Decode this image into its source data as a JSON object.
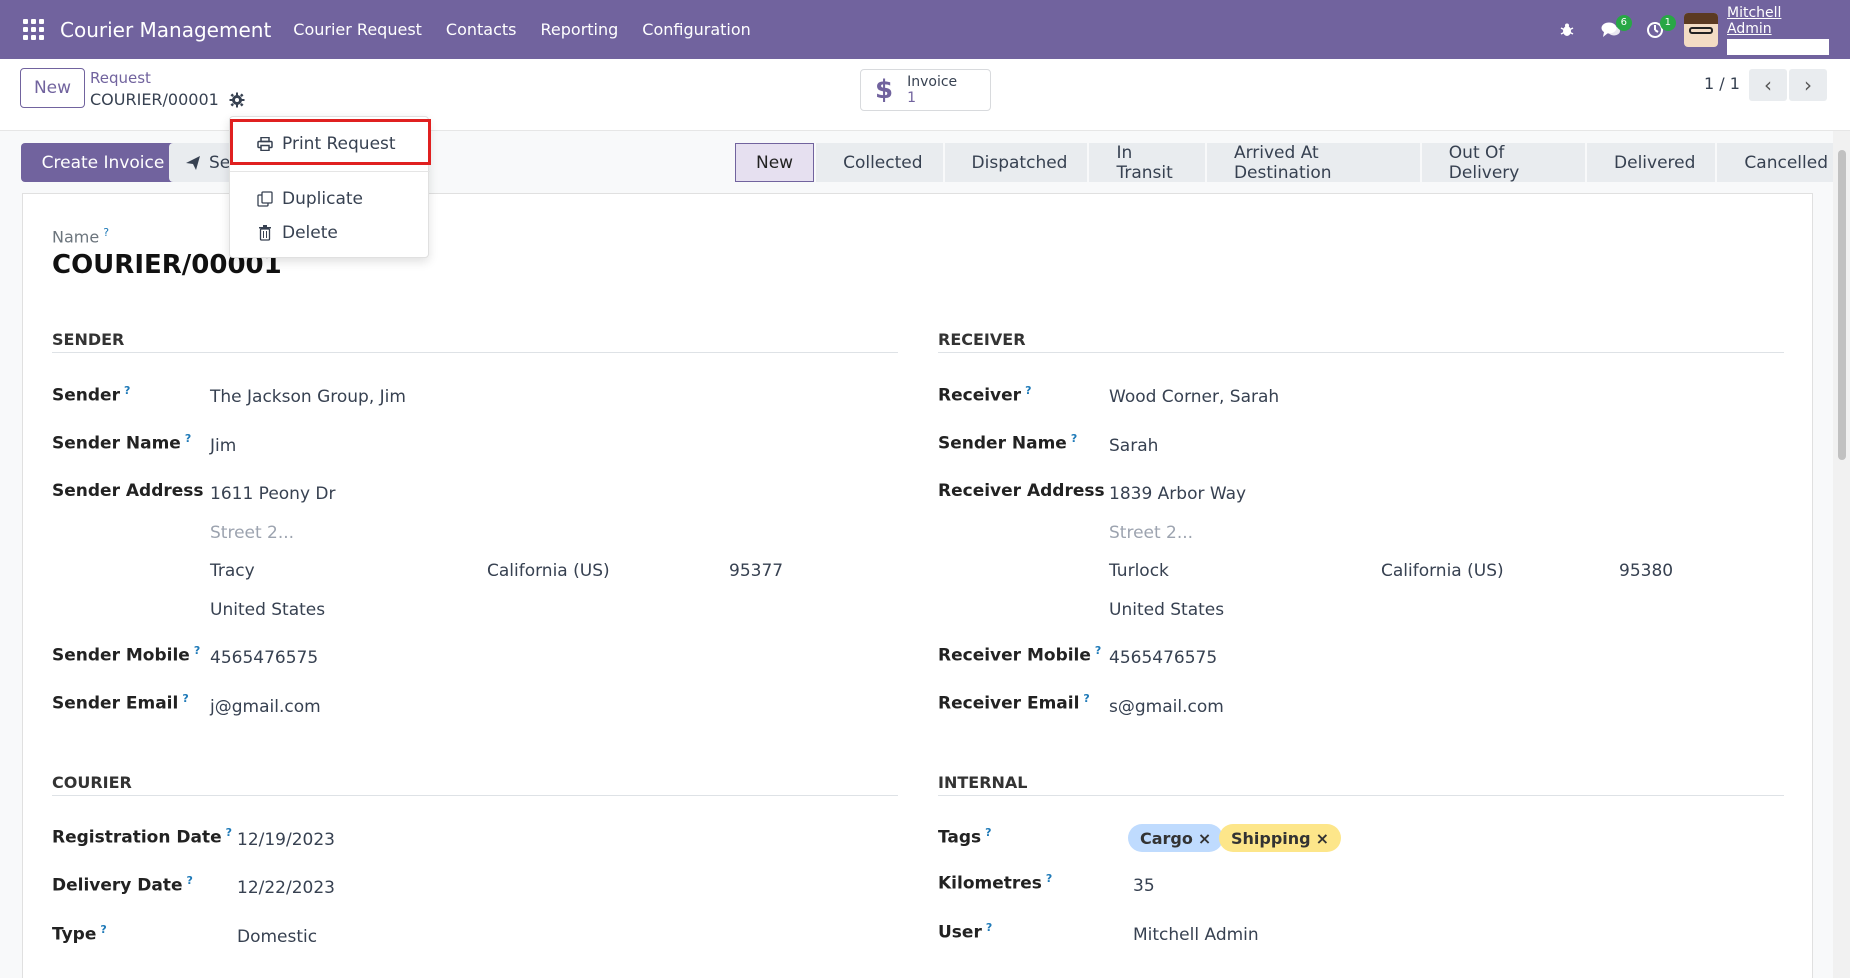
{
  "navbar": {
    "brand": "Courier Management",
    "menu": [
      "Courier Request",
      "Contacts",
      "Reporting",
      "Configuration"
    ],
    "messages_badge": "6",
    "activity_badge": "1",
    "user_name": "Mitchell Admin",
    "accent_color": "#71639e"
  },
  "control": {
    "new_label": "New",
    "breadcrumb_parent": "Request",
    "breadcrumb_current": "COURIER/00001",
    "smart_button_label": "Invoice",
    "smart_button_value": "1",
    "pager": "1 / 1"
  },
  "actions": {
    "create_invoice": "Create Invoice",
    "send_partial": "Se"
  },
  "stages": [
    "New",
    "Collected",
    "Dispatched",
    "In Transit",
    "Arrived At Destination",
    "Out Of Delivery",
    "Delivered",
    "Cancelled"
  ],
  "active_stage": "New",
  "dropdown": {
    "print": "Print Request",
    "duplicate": "Duplicate",
    "delete": "Delete"
  },
  "form": {
    "name_label": "Name",
    "name_value": "COURIER/00001",
    "help_mark": "?",
    "sender": {
      "section": "SENDER",
      "sender_label": "Sender",
      "sender_value": "The Jackson Group, Jim",
      "name_label": "Sender Name",
      "name_value": "Jim",
      "address_label": "Sender Address",
      "street": "1611 Peony Dr",
      "street2_placeholder": "Street 2...",
      "city": "Tracy",
      "state": "California (US)",
      "zip": "95377",
      "country": "United States",
      "mobile_label": "Sender Mobile",
      "mobile_value": "4565476575",
      "email_label": "Sender Email",
      "email_value": "j@gmail.com"
    },
    "receiver": {
      "section": "RECEIVER",
      "receiver_label": "Receiver",
      "receiver_value": "Wood Corner, Sarah",
      "name_label": "Sender Name",
      "name_value": "Sarah",
      "address_label": "Receiver Address",
      "street": "1839 Arbor Way",
      "street2_placeholder": "Street 2...",
      "city": "Turlock",
      "state": "California (US)",
      "zip": "95380",
      "country": "United States",
      "mobile_label": "Receiver Mobile",
      "mobile_value": "4565476575",
      "email_label": "Receiver Email",
      "email_value": "s@gmail.com"
    },
    "courier": {
      "section": "COURIER",
      "reg_label": "Registration Date",
      "reg_value": "12/19/2023",
      "delivery_label": "Delivery Date",
      "delivery_value": "12/22/2023",
      "type_label": "Type",
      "type_value": "Domestic"
    },
    "internal": {
      "section": "INTERNAL",
      "tags_label": "Tags",
      "tags": [
        {
          "name": "Cargo",
          "color": "#bfdbfe"
        },
        {
          "name": "Shipping",
          "color": "#fde68a"
        }
      ],
      "km_label": "Kilometres",
      "km_value": "35",
      "user_label": "User",
      "user_value": "Mitchell Admin"
    }
  }
}
